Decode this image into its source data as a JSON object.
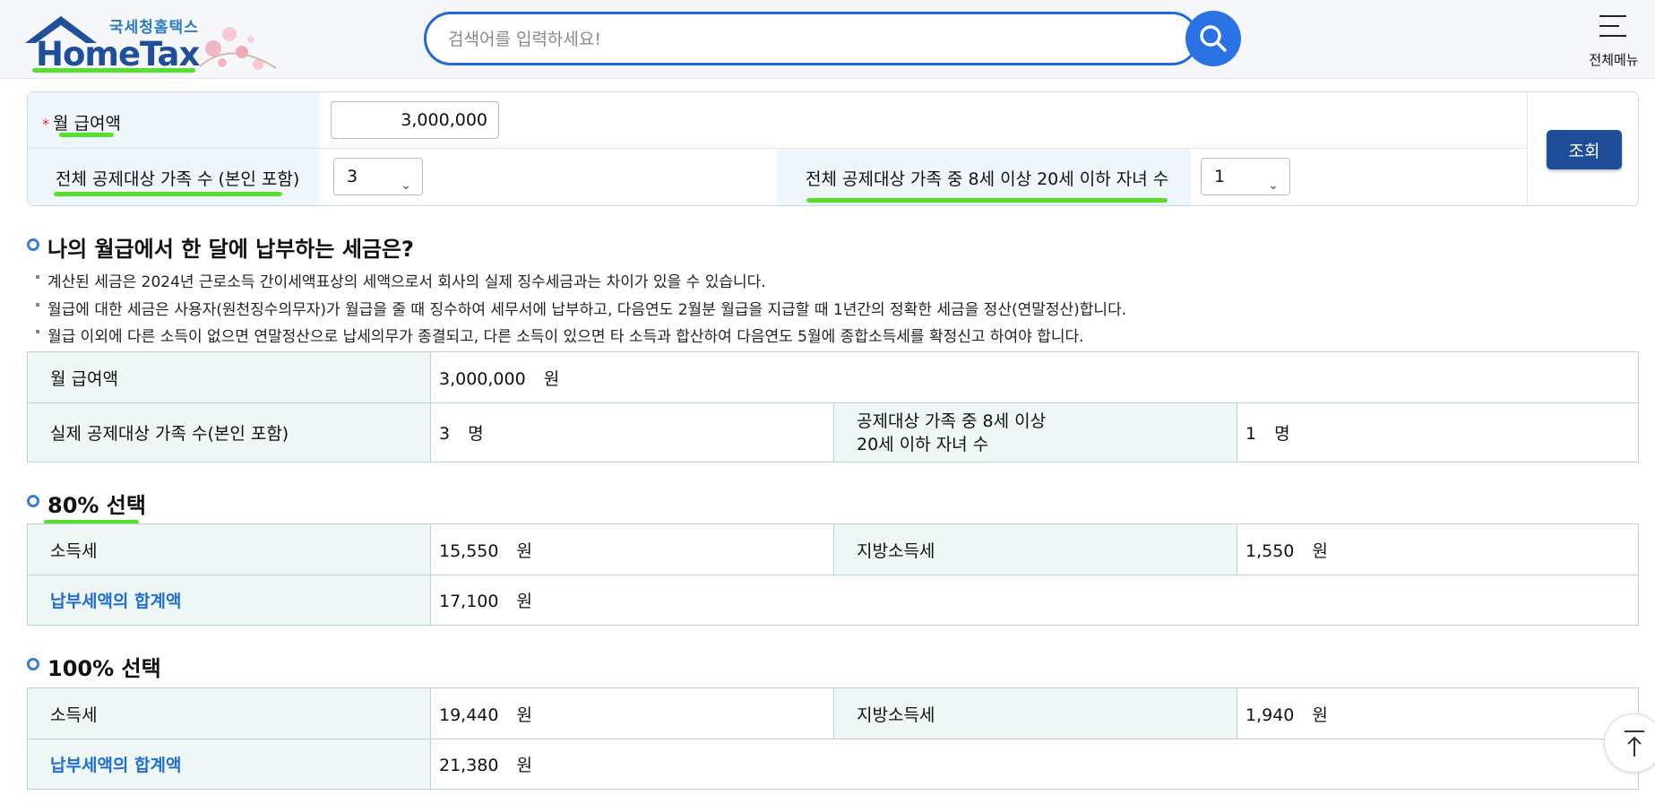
{
  "header": {
    "logo_kr": "국세청홈택스",
    "logo_main": "HomeTax",
    "search_placeholder": "검색어를 입력하세요!",
    "menu_label": "전체메뉴"
  },
  "form": {
    "salary_label": "월 급여액",
    "salary_value": "3,000,000",
    "family_label": "전체 공제대상 가족 수 (본인 포함)",
    "family_value": "3",
    "children_label": "전체 공제대상 가족 중 8세 이상 20세 이하 자녀 수",
    "children_value": "1",
    "query_button": "조회"
  },
  "result": {
    "title": "나의 월급에서 한 달에 납부하는 세금은?",
    "notes": [
      "계산된 세금은  2024년  근로소득 간이세액표상의 세액으로서 회사의 실제 징수세금과는 차이가 있을 수 있습니다.",
      "월급에 대한 세금은 사용자(원천징수의무자)가 월급을 줄 때 징수하여 세무서에 납부하고, 다음연도 2월분 월급을 지급할 때 1년간의 정확한 세금을 정산(연말정산)합니다.",
      "월급 이외에 다른 소득이 없으면 연말정산으로 납세의무가 종결되고, 다른 소득이 있으면 타 소득과 합산하여 다음연도 5월에 종합소득세를 확정신고 하여야 합니다."
    ],
    "summary": {
      "salary_label": "월 급여액",
      "salary_value": "3,000,000",
      "salary_unit": "원",
      "family_label": "실제 공제대상 가족 수(본인 포함)",
      "family_value": "3",
      "family_unit": "명",
      "children_label_1": "공제대상 가족 중 8세 이상",
      "children_label_2": "20세 이하 자녀 수",
      "children_value": "1",
      "children_unit": "명"
    }
  },
  "sections": [
    {
      "title": "80% 선택",
      "income_tax_label": "소득세",
      "income_tax_value": "15,550",
      "local_tax_label": "지방소득세",
      "local_tax_value": "1,550",
      "total_label": "납부세액의 합계액",
      "total_value": "17,100",
      "unit": "원"
    },
    {
      "title": "100% 선택",
      "income_tax_label": "소득세",
      "income_tax_value": "19,440",
      "local_tax_label": "지방소득세",
      "local_tax_value": "1,940",
      "total_label": "납부세액의 합계액",
      "total_value": "21,380",
      "unit": "원"
    }
  ],
  "colors": {
    "brand_blue": "#1f4f9b",
    "search_blue": "#2a72e4",
    "highlight_green": "#55e02a",
    "link_blue": "#1f6ed4"
  }
}
